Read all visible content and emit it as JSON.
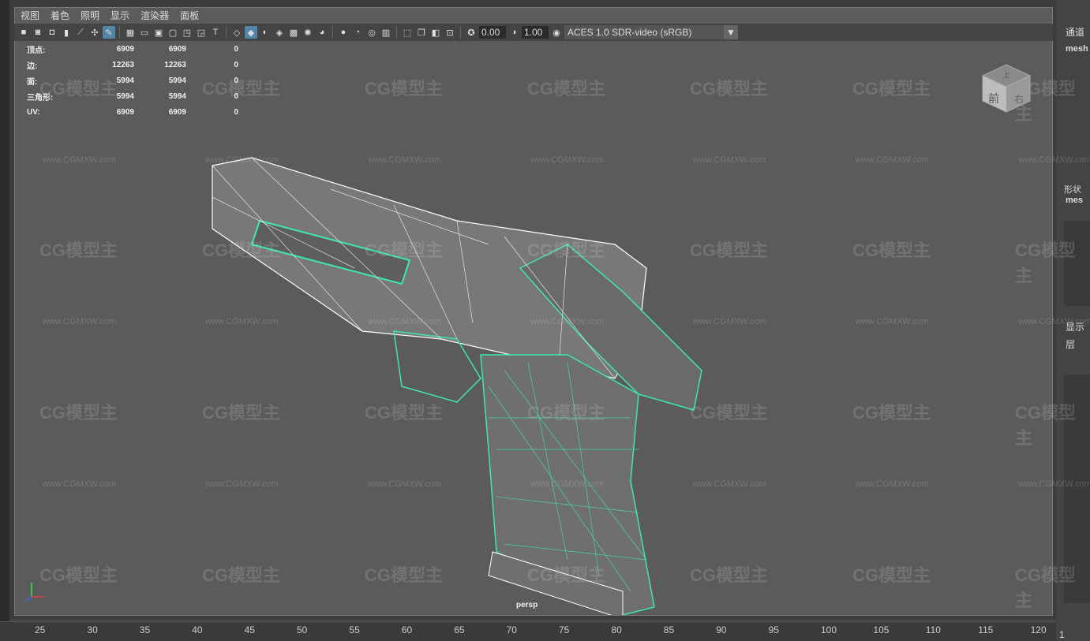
{
  "menu": [
    "视图",
    "着色",
    "照明",
    "显示",
    "渲染器",
    "面板"
  ],
  "toolbar": {
    "exposure": "0.00",
    "gamma": "1.00",
    "color_space": "ACES 1.0 SDR-video (sRGB)"
  },
  "stats": {
    "rows": [
      {
        "label": "顶点:",
        "a": "6909",
        "b": "6909",
        "c": "0"
      },
      {
        "label": "边:",
        "a": "12263",
        "b": "12263",
        "c": "0"
      },
      {
        "label": "面:",
        "a": "5994",
        "b": "5994",
        "c": "0"
      },
      {
        "label": "三角形:",
        "a": "5994",
        "b": "5994",
        "c": "0"
      },
      {
        "label": "UV:",
        "a": "6909",
        "b": "6909",
        "c": "0"
      }
    ]
  },
  "watermark": {
    "logo": "CG模型主",
    "url": "www.CGMXW.com"
  },
  "viewcube": {
    "top": "上",
    "front": "前",
    "right": "右"
  },
  "camera": "persp",
  "timeline": [
    "25",
    "30",
    "35",
    "40",
    "45",
    "50",
    "55",
    "60",
    "65",
    "70",
    "75",
    "80",
    "85",
    "90",
    "95",
    "100",
    "105",
    "110",
    "115",
    "120"
  ],
  "right_panel": {
    "channels": "通道",
    "mesh": "mesh",
    "shape": "形状",
    "mesh2": "mes",
    "display": "显示",
    "layer": "层",
    "frame": "1"
  }
}
